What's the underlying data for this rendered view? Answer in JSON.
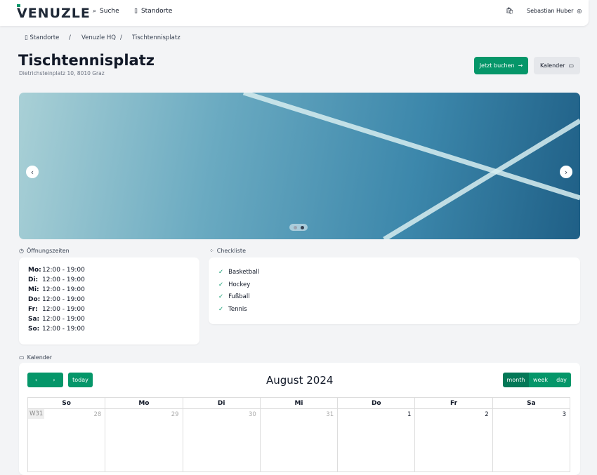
{
  "nav": {
    "logo": "VENUZLE",
    "search": "Suche",
    "locations": "Standorte",
    "user": "Sebastian Huber"
  },
  "breadcrumb": [
    "Standorte",
    "Venuzle HQ",
    "Tischtennisplatz"
  ],
  "page": {
    "title": "Tischtennisplatz",
    "address": "Dietrichsteinplatz 10, 8010 Graz",
    "book": "Jetzt buchen",
    "calendar": "Kalender"
  },
  "carousel": {
    "slides": 2,
    "active": 2
  },
  "hours": {
    "title": "Öffnungszeiten",
    "rows": [
      {
        "d": "Mo:",
        "t": "12:00 - 19:00"
      },
      {
        "d": "Di:",
        "t": "12:00 - 19:00"
      },
      {
        "d": "Mi:",
        "t": "12:00 - 19:00"
      },
      {
        "d": "Do:",
        "t": "12:00 - 19:00"
      },
      {
        "d": "Fr:",
        "t": "12:00 - 19:00"
      },
      {
        "d": "Sa:",
        "t": "12:00 - 19:00"
      },
      {
        "d": "So:",
        "t": "12:00 - 19:00"
      }
    ]
  },
  "checklist": {
    "title": "Checkliste",
    "items": [
      "Basketball",
      "Hockey",
      "Fußball",
      "Tennis"
    ]
  },
  "calendar": {
    "section": "Kalender",
    "today": "today",
    "title": "August 2024",
    "views": [
      "month",
      "week",
      "day"
    ],
    "days": [
      "So",
      "Mo",
      "Di",
      "Mi",
      "Do",
      "Fr",
      "Sa"
    ],
    "week": "W31",
    "dates": [
      "28",
      "29",
      "30",
      "31",
      "1",
      "2",
      "3"
    ]
  },
  "colors": {
    "accent": "#059669"
  }
}
